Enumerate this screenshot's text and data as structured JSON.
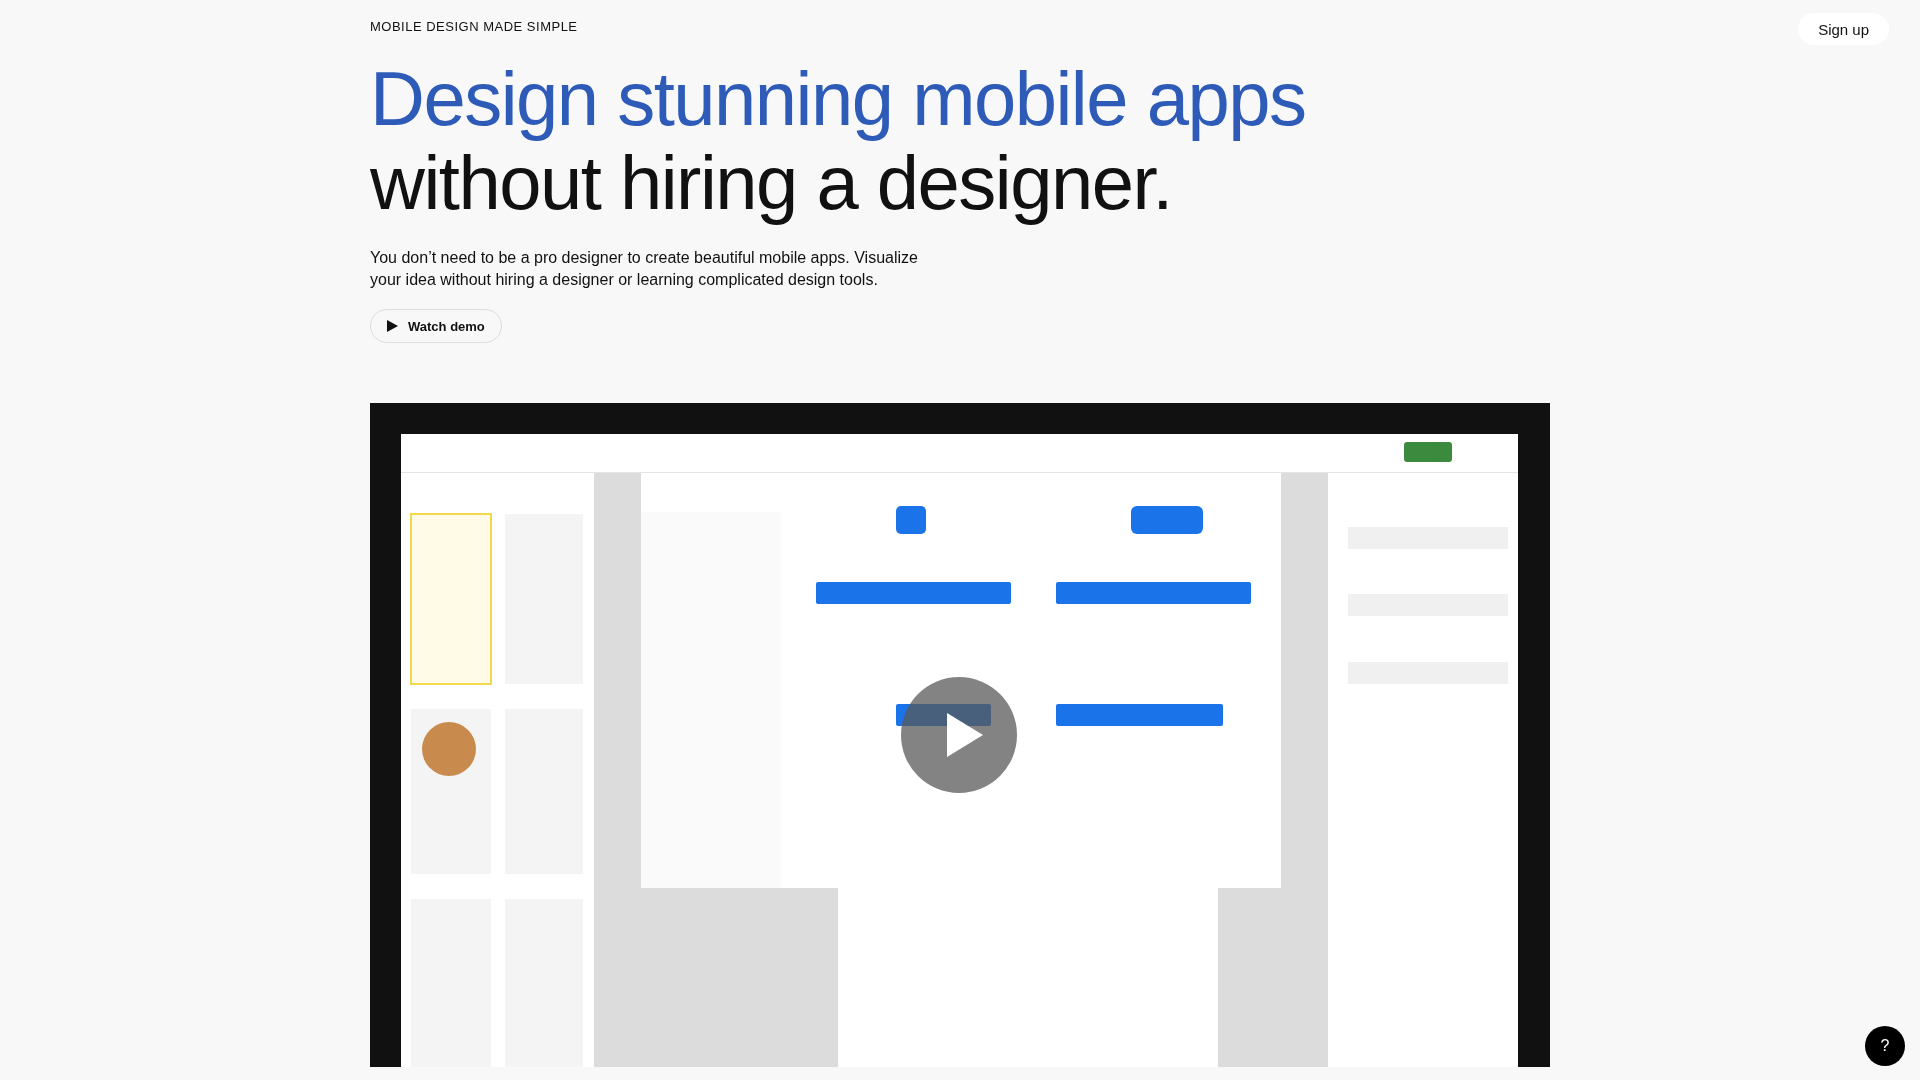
{
  "eyebrow": "MOBILE DESIGN MADE SIMPLE",
  "signup_button": "Sign up",
  "headline": {
    "highlight": "Design stunning mobile apps",
    "rest": "without hiring a designer."
  },
  "description": "You don’t need to be a pro designer to create beautiful mobile apps. Visualize your idea without hiring a designer or learning complicated design tools.",
  "demo_button": "Watch demo",
  "help_button": "?"
}
